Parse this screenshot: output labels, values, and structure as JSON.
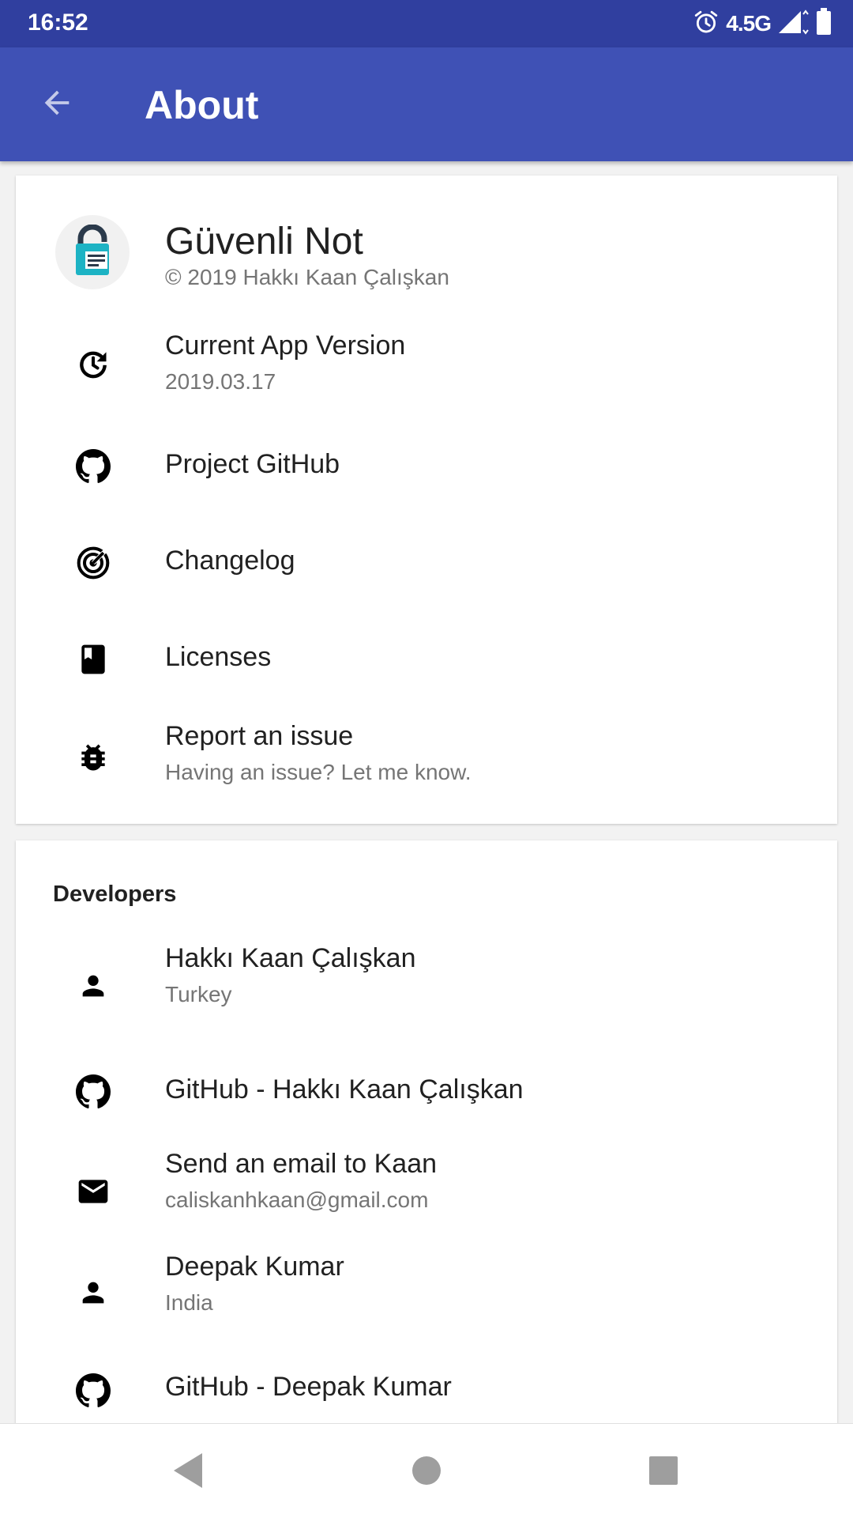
{
  "status_bar": {
    "time": "16:52",
    "network": "4.5G",
    "icons": [
      "alarm-icon",
      "signal-icon",
      "battery-icon"
    ]
  },
  "app_bar": {
    "title": "About",
    "back_icon": "arrow-back-icon"
  },
  "about": {
    "app_name": "Güvenli Not",
    "copyright": "© 2019 Hakkı Kaan Çalışkan",
    "items": [
      {
        "icon": "update-icon",
        "label": "Current App Version",
        "sublabel": "2019.03.17"
      },
      {
        "icon": "github-icon",
        "label": "Project GitHub"
      },
      {
        "icon": "changelog-icon",
        "label": "Changelog"
      },
      {
        "icon": "book-icon",
        "label": "Licenses"
      },
      {
        "icon": "bug-icon",
        "label": "Report an issue",
        "sublabel": "Having an issue? Let me know."
      }
    ]
  },
  "developers": {
    "title": "Developers",
    "items": [
      {
        "icon": "person-icon",
        "label": "Hakkı Kaan Çalışkan",
        "sublabel": "Turkey"
      },
      {
        "icon": "github-icon",
        "label": "GitHub - Hakkı Kaan Çalışkan"
      },
      {
        "icon": "email-icon",
        "label": "Send an email to Kaan",
        "sublabel": "caliskanhkaan@gmail.com"
      },
      {
        "icon": "person-icon",
        "label": "Deepak Kumar",
        "sublabel": "India"
      },
      {
        "icon": "github-icon",
        "label": "GitHub - Deepak Kumar"
      }
    ]
  },
  "colors": {
    "status_bar": "#303F9F",
    "app_bar": "#3F51B5",
    "logo_teal": "#1DB3C4",
    "logo_dark": "#2B3A4B"
  },
  "nav_bar": {
    "icons": [
      "nav-back-icon",
      "nav-home-icon",
      "nav-recents-icon"
    ]
  }
}
